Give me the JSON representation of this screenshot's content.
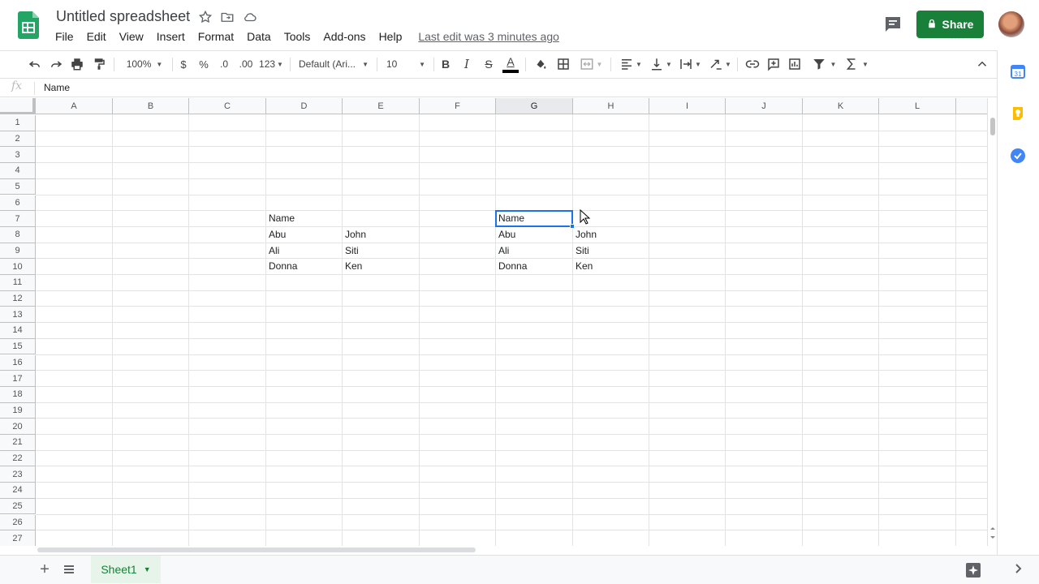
{
  "title_bar": {
    "doc_title": "Untitled spreadsheet",
    "menu": [
      "File",
      "Edit",
      "View",
      "Insert",
      "Format",
      "Data",
      "Tools",
      "Add-ons",
      "Help"
    ],
    "last_edit": "Last edit was 3 minutes ago",
    "share_label": "Share"
  },
  "toolbar": {
    "zoom": "100%",
    "currency": "$",
    "percent": "%",
    "decrease_decimal": ".0",
    "increase_decimal": ".00",
    "more_formats": "123",
    "font_family": "Default (Ari...",
    "font_size": "10",
    "bold": "B",
    "italic": "I",
    "strikethrough": "S",
    "text_color": "A",
    "text_color_value": "#000000"
  },
  "formula_bar": {
    "fx": "fx",
    "value": "Name"
  },
  "grid": {
    "columns": [
      "A",
      "B",
      "C",
      "D",
      "E",
      "F",
      "G",
      "H",
      "I",
      "J",
      "K",
      "L"
    ],
    "rows": [
      "1",
      "2",
      "3",
      "4",
      "5",
      "6",
      "7",
      "8",
      "9",
      "10",
      "11",
      "12",
      "13",
      "14",
      "15",
      "16",
      "17",
      "18",
      "19",
      "20",
      "21",
      "22",
      "23",
      "24",
      "25",
      "26",
      "27"
    ],
    "selected_column": "G",
    "active_cell": "G7",
    "cells": {
      "D7": "Name",
      "D8": "Abu",
      "D9": "Ali",
      "D10": "Donna",
      "E8": "John",
      "E9": "Siti",
      "E10": "Ken",
      "G7": "Name",
      "G8": "Abu",
      "G9": "Ali",
      "G10": "Donna",
      "H8": "John",
      "H9": "Siti",
      "H10": "Ken"
    }
  },
  "bottom_bar": {
    "add_sheet": "+",
    "sheet_tab": "Sheet1"
  },
  "colors": {
    "brand_green": "#188038",
    "selection_blue": "#1a73e8",
    "header_bg": "#f8f9fa"
  },
  "icons": {
    "logo": "sheets-logo",
    "comment": "comment-icon",
    "calendar": "calendar-icon",
    "keep": "keep-icon",
    "tasks": "tasks-icon"
  }
}
